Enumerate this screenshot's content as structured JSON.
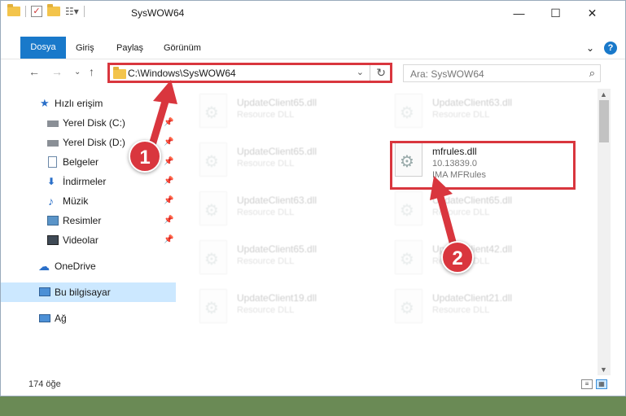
{
  "window": {
    "title": "SysWOW64",
    "minimize": "—",
    "maximize": "☐",
    "close": "✕"
  },
  "ribbon": {
    "tabs": [
      "Dosya",
      "Giriş",
      "Paylaş",
      "Görünüm"
    ],
    "expand": "⌄",
    "help": "?"
  },
  "address": {
    "path": "C:\\Windows\\SysWOW64",
    "search_placeholder": "Ara: SysWOW64"
  },
  "nav": {
    "items": [
      {
        "label": "Hızlı erişim",
        "icon": "star-icon",
        "pinned": false
      },
      {
        "label": "Yerel Disk (C:)",
        "icon": "drive-icon",
        "pinned": true
      },
      {
        "label": "Yerel Disk (D:)",
        "icon": "drive-icon",
        "pinned": true
      },
      {
        "label": "Belgeler",
        "icon": "documents-icon",
        "pinned": true
      },
      {
        "label": "İndirmeler",
        "icon": "download-icon",
        "pinned": true
      },
      {
        "label": "Müzik",
        "icon": "music-icon",
        "pinned": true
      },
      {
        "label": "Resimler",
        "icon": "pictures-icon",
        "pinned": true
      },
      {
        "label": "Videolar",
        "icon": "video-icon",
        "pinned": true
      },
      {
        "label": "OneDrive",
        "icon": "cloud-icon",
        "pinned": false
      },
      {
        "label": "Bu bilgisayar",
        "icon": "computer-icon",
        "pinned": false
      },
      {
        "label": "Ağ",
        "icon": "network-icon",
        "pinned": false
      }
    ]
  },
  "files": [
    {
      "name": "UpdateClient65.dll",
      "type": "Resource DLL",
      "desc": "",
      "highlight": false
    },
    {
      "name": "UpdateClient63.dll",
      "type": "Resource DLL",
      "desc": "",
      "highlight": false
    },
    {
      "name": "UpdateClient65.dll",
      "type": "Resource DLL",
      "desc": "",
      "highlight": false
    },
    {
      "name": "mfrules.dll",
      "type": "10.13839.0",
      "desc": "IMA MFRules",
      "highlight": true
    },
    {
      "name": "UpdateClient63.dll",
      "type": "Resource DLL",
      "desc": "",
      "highlight": false
    },
    {
      "name": "UpdateClient65.dll",
      "type": "Resource DLL",
      "desc": "",
      "highlight": false
    },
    {
      "name": "UpdateClient65.dll",
      "type": "Resource DLL",
      "desc": "",
      "highlight": false
    },
    {
      "name": "UpdateClient42.dll",
      "type": "Resource DLL",
      "desc": "",
      "highlight": false
    },
    {
      "name": "UpdateClient19.dll",
      "type": "Resource DLL",
      "desc": "",
      "highlight": false
    },
    {
      "name": "UpdateClient21.dll",
      "type": "Resource DLL",
      "desc": "",
      "highlight": false
    }
  ],
  "status": {
    "count": "174 öğe"
  },
  "callouts": [
    "1",
    "2"
  ],
  "colors": {
    "accent": "#1979ca",
    "highlight": "#d9363e",
    "selection": "#cce8ff"
  }
}
